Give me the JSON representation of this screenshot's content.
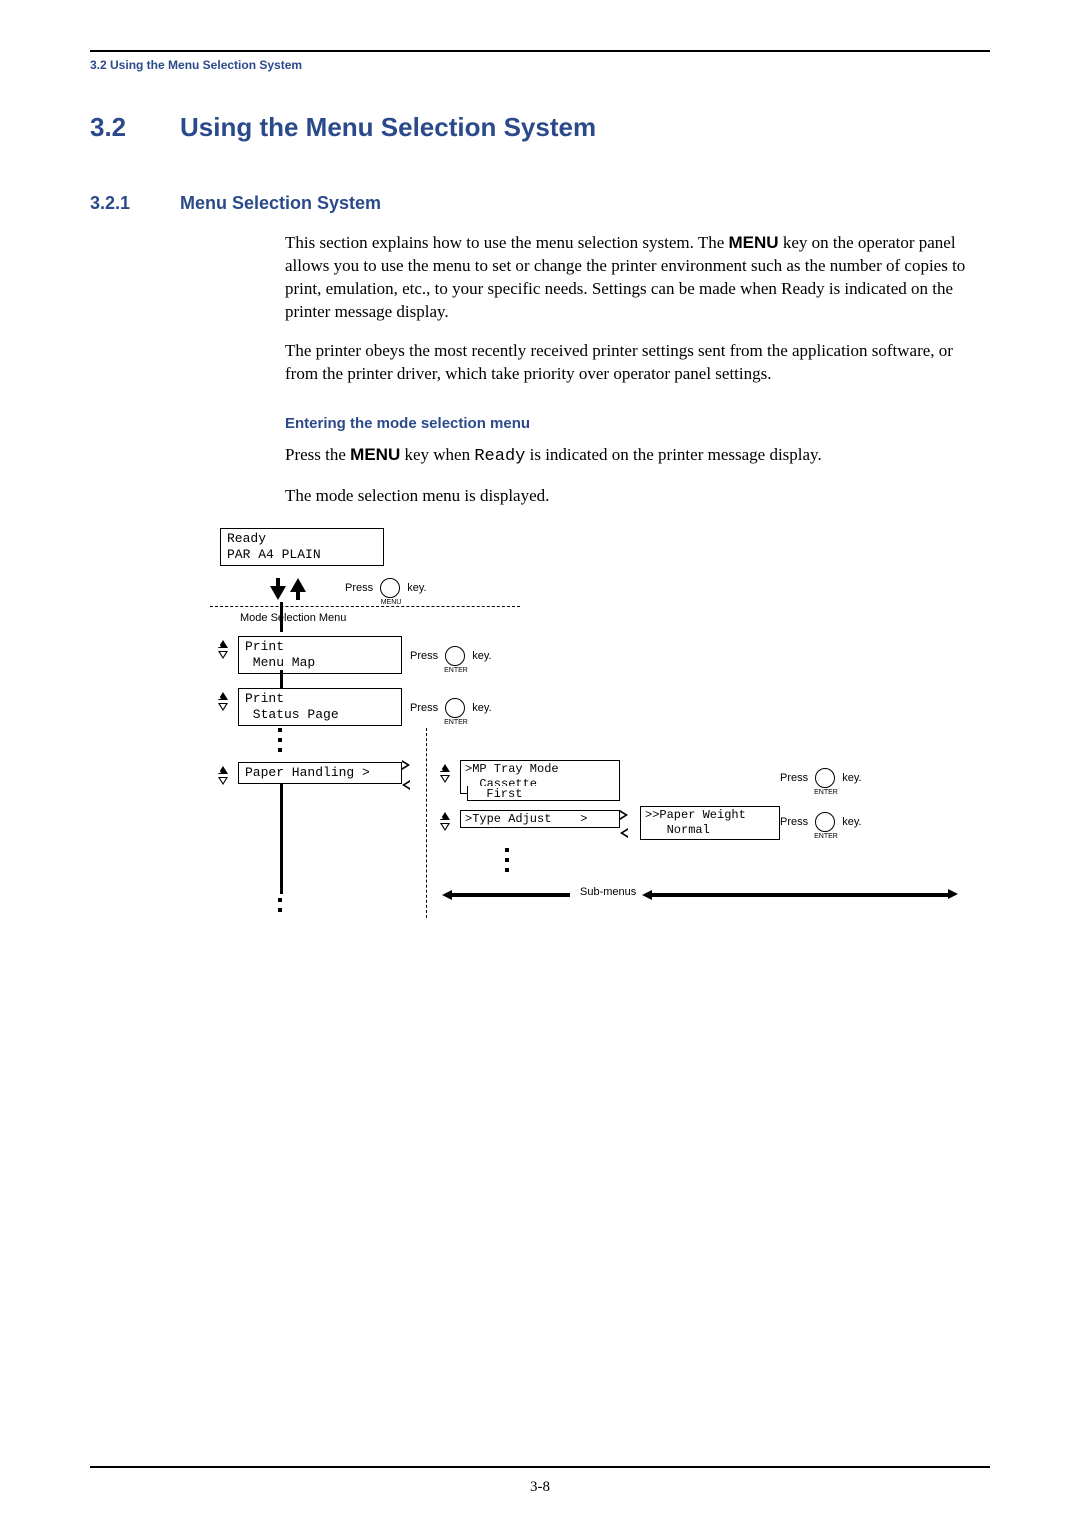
{
  "running_head": "3.2 Using the Menu Selection System",
  "h1_num": "3.2",
  "h1_title": "Using the Menu Selection System",
  "h2_num": "3.2.1",
  "h2_title": "Menu Selection System",
  "para1_a": "This section explains how to use the menu selection system. The ",
  "para1_menu": "MENU",
  "para1_b": " key on the operator panel allows you to use the menu to set or change the printer environment such as the number of copies to print, emulation, etc., to your specific needs. Settings can be made when Ready is indicated on the printer message display.",
  "para2": "The printer obeys the most recently received printer settings sent from the application software, or from the printer driver, which take priority over operator panel settings.",
  "subhead": "Entering the mode selection menu",
  "para3_a": "Press the ",
  "para3_menu": "MENU",
  "para3_b": " key when ",
  "para3_ready": "Ready",
  "para3_c": " is indicated on the printer message display.",
  "para4": "The mode selection menu is displayed.",
  "diagram": {
    "lcd_ready": "Ready\nPAR A4 PLAIN",
    "press": "Press",
    "key": "key.",
    "btn_menu": "MENU",
    "btn_enter": "ENTER",
    "mode_menu_label": "Mode Selection Menu",
    "lcd_menu_map": "Print\n Menu Map",
    "lcd_status_page": "Print\n Status Page",
    "lcd_paper_handling": "Paper Handling >",
    "lcd_mp_tray": ">MP Tray Mode\n  Cassette",
    "lcd_mp_stack": "  First",
    "lcd_type_adjust": ">Type Adjust    >",
    "lcd_paper_weight": ">>Paper Weight\n   Normal",
    "submenus": "Sub-menus"
  },
  "page_number": "3-8"
}
